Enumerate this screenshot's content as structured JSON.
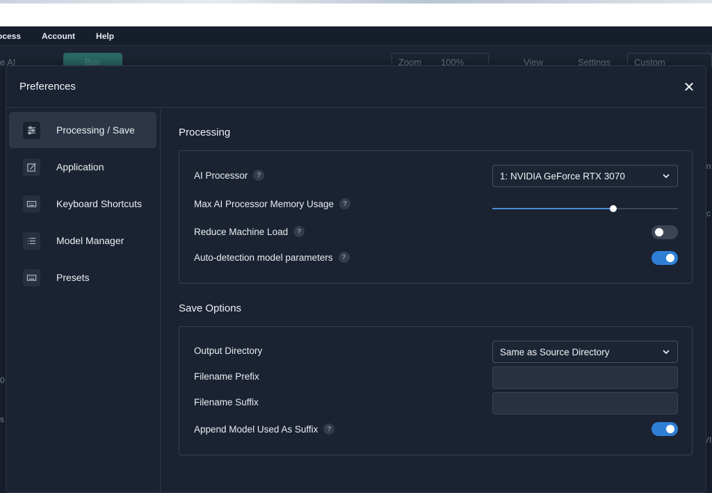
{
  "menubar": {
    "items": [
      "ocess",
      "Account",
      "Help"
    ]
  },
  "toolbar": {
    "app_fragment": "e AI",
    "buy_label": "Buy",
    "zoom_label": "Zoom",
    "zoom_value": "100%",
    "view_label": "View",
    "settings_label": "Settings",
    "custom_label": "Custom"
  },
  "background": {
    "left_fragments": [
      "0",
      "s"
    ],
    "right_fragments": [
      "n",
      "c",
      "VI"
    ]
  },
  "dialog": {
    "title": "Preferences",
    "close_symbol": "✕"
  },
  "sidebar": {
    "items": [
      {
        "label": "Processing / Save",
        "icon": "sliders-icon",
        "active": true
      },
      {
        "label": "Application",
        "icon": "edit-window-icon",
        "active": false
      },
      {
        "label": "Keyboard Shortcuts",
        "icon": "keyboard-icon",
        "active": false
      },
      {
        "label": "Model Manager",
        "icon": "list-icon",
        "active": false
      },
      {
        "label": "Presets",
        "icon": "keyboard-icon",
        "active": false
      }
    ]
  },
  "processing": {
    "title": "Processing",
    "ai_processor_label": "AI Processor",
    "ai_processor_value": "1: NVIDIA GeForce RTX 3070",
    "memory_label": "Max AI Processor Memory Usage",
    "memory_fraction": 0.65,
    "reduce_load_label": "Reduce Machine Load",
    "reduce_load_on": false,
    "auto_detect_label": "Auto-detection model parameters",
    "auto_detect_on": true,
    "help_symbol": "?"
  },
  "save_options": {
    "title": "Save Options",
    "output_dir_label": "Output Directory",
    "output_dir_value": "Same as Source Directory",
    "prefix_label": "Filename Prefix",
    "prefix_value": "",
    "suffix_label": "Filename Suffix",
    "suffix_value": "",
    "append_model_label": "Append Model Used As Suffix",
    "append_model_on": true
  },
  "colors": {
    "accent": "#2f7fd6",
    "dialog_bg": "#1b2332",
    "active_nav": "#2c3646"
  }
}
